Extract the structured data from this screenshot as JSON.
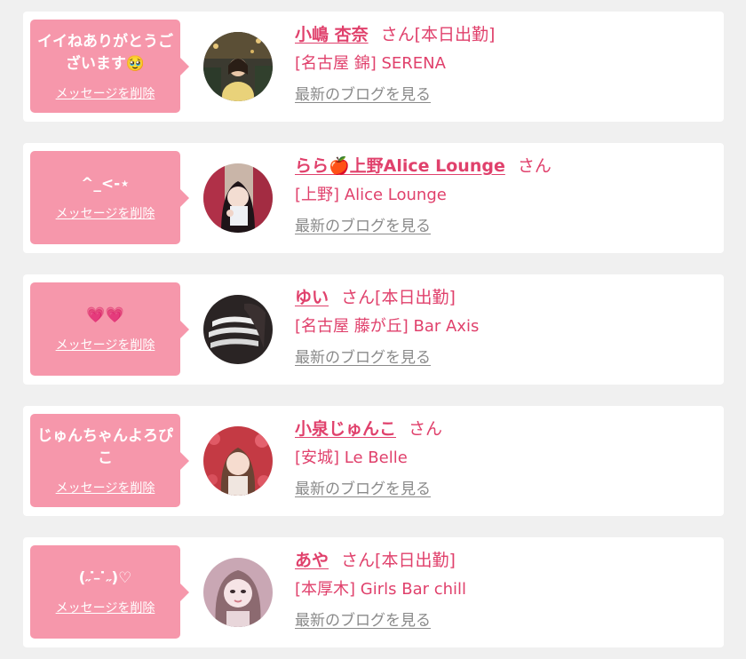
{
  "colors": {
    "bubble": "#f697ab",
    "accent": "#e0416c",
    "muted": "#8a8a8a",
    "background": "#f0f0f0"
  },
  "items": [
    {
      "message": "イイねありがとうございます🥹",
      "delete_label": "メッセージを削除",
      "name": "小嶋 杏奈",
      "honorific": "さん",
      "status": "[本日出勤]",
      "shop": "[名古屋 錦] SERENA",
      "blog_label": "最新のブログを見る"
    },
    {
      "message": "^_<-⋆",
      "delete_label": "メッセージを削除",
      "name": "らら🍎上野Alice Lounge",
      "honorific": "さん",
      "status": "",
      "shop": "[上野] Alice Lounge",
      "blog_label": "最新のブログを見る"
    },
    {
      "message": "💗💗",
      "delete_label": "メッセージを削除",
      "name": "ゆい",
      "honorific": "さん",
      "status": "[本日出勤]",
      "shop": "[名古屋 藤が丘] Bar Axis",
      "blog_label": "最新のブログを見る"
    },
    {
      "message": "じゅんちゃんよろぴこ",
      "delete_label": "メッセージを削除",
      "name": "小泉じゅんこ",
      "honorific": "さん",
      "status": "",
      "shop": "[安城] Le Belle",
      "blog_label": "最新のブログを見る"
    },
    {
      "message": "(˶ ̇ ̵ ̇˶)♡",
      "delete_label": "メッセージを削除",
      "name": "あや",
      "honorific": "さん",
      "status": "[本日出勤]",
      "shop": "[本厚木] Girls Bar chill",
      "blog_label": "最新のブログを見る"
    }
  ]
}
